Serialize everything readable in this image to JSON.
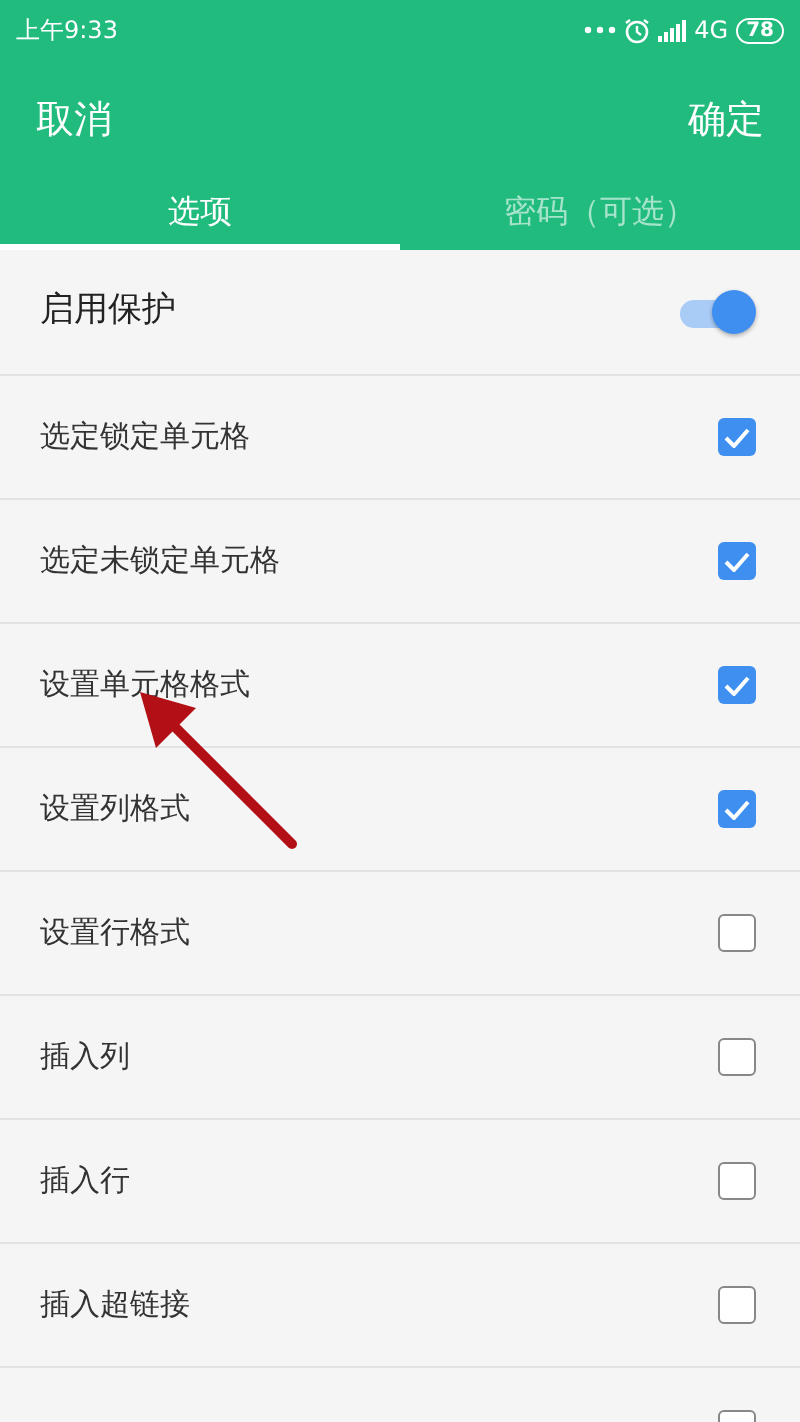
{
  "status_bar": {
    "time": "上午9:33",
    "network": "4G",
    "battery": "78"
  },
  "header": {
    "cancel": "取消",
    "confirm": "确定"
  },
  "tabs": [
    {
      "label": "选项",
      "selected": true
    },
    {
      "label": "密码（可选）",
      "selected": false
    }
  ],
  "protection": {
    "label": "启用保护",
    "on": true
  },
  "options": [
    {
      "label": "选定锁定单元格",
      "checked": true
    },
    {
      "label": "选定未锁定单元格",
      "checked": true
    },
    {
      "label": "设置单元格格式",
      "checked": true
    },
    {
      "label": "设置列格式",
      "checked": true
    },
    {
      "label": "设置行格式",
      "checked": false
    },
    {
      "label": "插入列",
      "checked": false
    },
    {
      "label": "插入行",
      "checked": false
    },
    {
      "label": "插入超链接",
      "checked": false
    },
    {
      "checked": false
    }
  ]
}
